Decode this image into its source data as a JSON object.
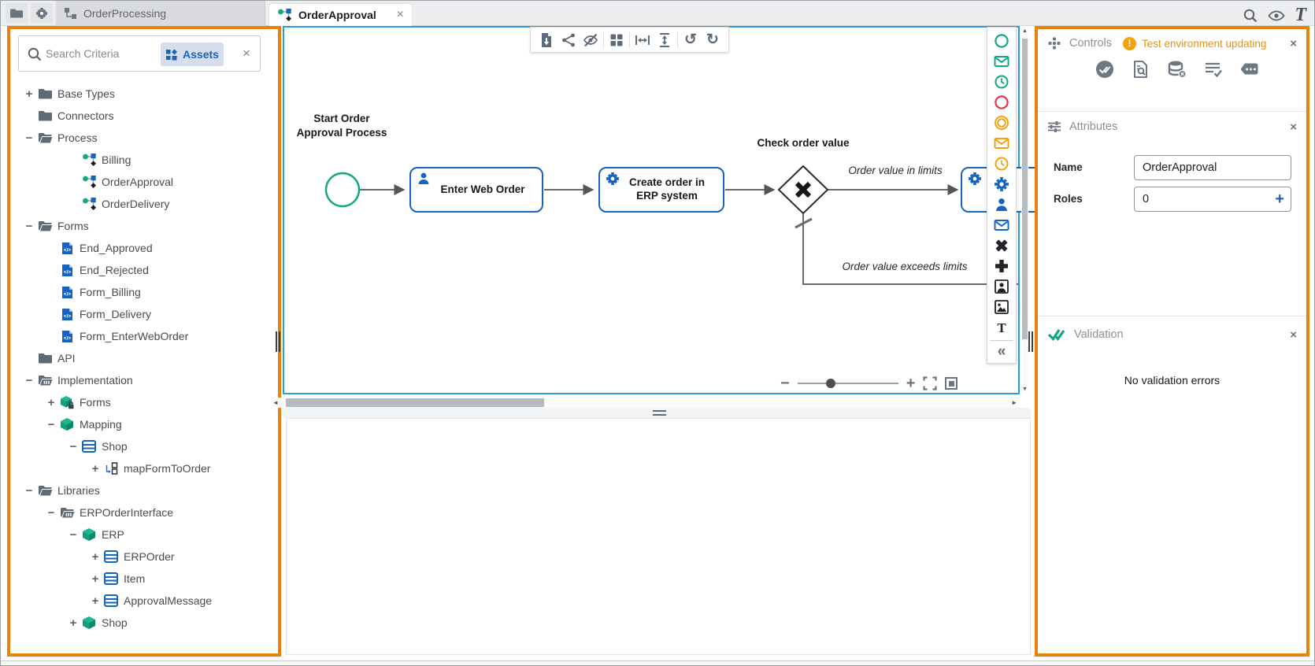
{
  "topbar": {
    "workspace_tab": {
      "label": "OrderProcessing"
    },
    "document_tab": {
      "label": "OrderApproval",
      "close": "×"
    },
    "logo_text": "T"
  },
  "sidebar": {
    "search": {
      "placeholder": "Search Criteria"
    },
    "filter_chip": {
      "label": "Assets"
    },
    "close": "×",
    "tree": [
      {
        "label": "Base Types",
        "expander": "+",
        "icon": "folder"
      },
      {
        "label": "Connectors",
        "expander": "",
        "icon": "folder"
      },
      {
        "label": "Process",
        "expander": "−",
        "icon": "folderOpen"
      },
      {
        "label": "Billing",
        "expander": "",
        "icon": "process"
      },
      {
        "label": "OrderApproval",
        "expander": "",
        "icon": "process"
      },
      {
        "label": "OrderDelivery",
        "expander": "",
        "icon": "process"
      },
      {
        "label": "Forms",
        "expander": "−",
        "icon": "folderOpen"
      },
      {
        "label": "End_Approved",
        "expander": "",
        "icon": "form"
      },
      {
        "label": "End_Rejected",
        "expander": "",
        "icon": "form"
      },
      {
        "label": "Form_Billing",
        "expander": "",
        "icon": "form"
      },
      {
        "label": "Form_Delivery",
        "expander": "",
        "icon": "form"
      },
      {
        "label": "Form_EnterWebOrder",
        "expander": "",
        "icon": "form"
      },
      {
        "label": "API",
        "expander": "",
        "icon": "folder"
      },
      {
        "label": "Implementation",
        "expander": "−",
        "icon": "folderLib"
      },
      {
        "label": "Forms",
        "expander": "+",
        "icon": "cubeLock"
      },
      {
        "label": "Mapping",
        "expander": "−",
        "icon": "cube"
      },
      {
        "label": "Shop",
        "expander": "−",
        "icon": "table"
      },
      {
        "label": "mapFormToOrder",
        "expander": "+",
        "icon": "map"
      },
      {
        "label": "Libraries",
        "expander": "−",
        "icon": "folderOpen"
      },
      {
        "label": "ERPOrderInterface",
        "expander": "−",
        "icon": "folderLib"
      },
      {
        "label": "ERP",
        "expander": "−",
        "icon": "cube"
      },
      {
        "label": "ERPOrder",
        "expander": "+",
        "icon": "table"
      },
      {
        "label": "Item",
        "expander": "+",
        "icon": "table"
      },
      {
        "label": "ApprovalMessage",
        "expander": "+",
        "icon": "table"
      },
      {
        "label": "Shop",
        "expander": "+",
        "icon": "cube"
      }
    ]
  },
  "canvas": {
    "toolbar_icons": [
      "export-document",
      "share",
      "hide-elements",
      "grid",
      "fit-width",
      "fit-height",
      "undo",
      "redo"
    ],
    "undo_glyph": "↺",
    "redo_glyph": "↻",
    "diagram": {
      "start_label": "Start Order Approval Process",
      "gateway_label": "Check order value",
      "task_enter": "Enter Web Order",
      "task_create": "Create order in ERP system",
      "edge_in_limits": "Order value in limits",
      "edge_exceeds": "Order value exceeds limits"
    },
    "zoom": {
      "minus": "−",
      "plus": "+"
    }
  },
  "palette_icons": [
    "start-event",
    "message-start-event",
    "timer-start-event",
    "end-event",
    "intermediate-event",
    "message-intermediate-event",
    "timer-intermediate-event",
    "service-task",
    "user-task",
    "send-task",
    "exclusive-gateway",
    "parallel-gateway",
    "user-portrait",
    "image",
    "text",
    "collapse"
  ],
  "palette_collapse_glyph": "«",
  "inspector": {
    "controls": {
      "title": "Controls",
      "warning": "Test environment updating",
      "warning_mark": "!",
      "close": "×",
      "icons": [
        "approve-check",
        "document-search",
        "database-clear",
        "list-check",
        "comment-dots"
      ]
    },
    "attributes": {
      "title": "Attributes",
      "close": "×",
      "name_label": "Name",
      "name_value": "OrderApproval",
      "roles_label": "Roles",
      "roles_value": "0",
      "add_role": "+"
    },
    "validation": {
      "title": "Validation",
      "close": "×",
      "message": "No validation errors"
    }
  },
  "colors": {
    "accent_orange": "#E8820D",
    "canvas_border_blue": "#2E9BDB",
    "teal": "#10A883",
    "blue": "#1565C0",
    "warning_orange": "#F5A10C"
  }
}
